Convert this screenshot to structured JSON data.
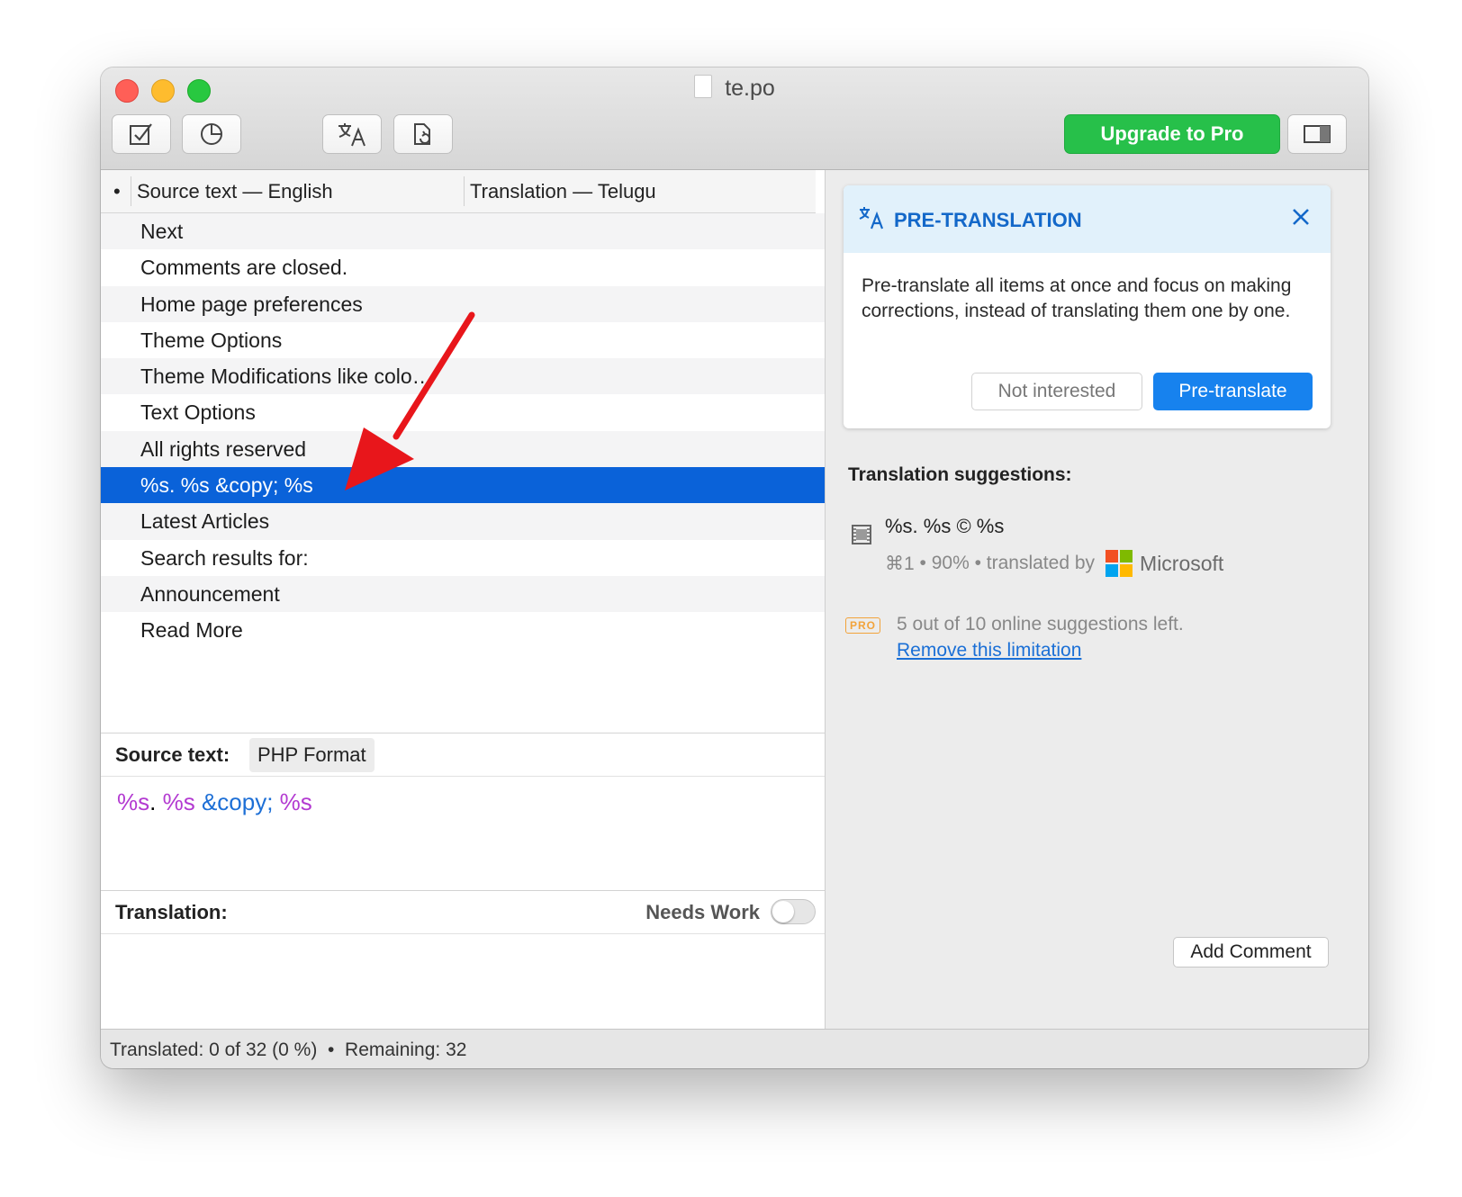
{
  "window": {
    "title": "te.po"
  },
  "toolbar": {
    "buttons": [
      {
        "name": "validate",
        "icon": "checkbox-edit-icon"
      },
      {
        "name": "statistics",
        "icon": "pie-chart-icon"
      },
      {
        "name": "pretranslate",
        "icon": "translate-icon"
      },
      {
        "name": "update",
        "icon": "document-sync-icon"
      },
      {
        "name": "sidebar",
        "icon": "sidebar-toggle-icon"
      }
    ],
    "upgrade_label": "Upgrade to Pro"
  },
  "list": {
    "bullet": "•",
    "col_source": "Source text — English",
    "col_translation": "Translation — Telugu",
    "rows": [
      "Next",
      "Comments are closed.",
      "Home page preferences",
      "Theme Options",
      "Theme Modifications like colo…",
      "Text Options",
      "All rights reserved",
      "%s. %s &copy; %s",
      "Latest Articles",
      "Search results for:",
      "Announcement",
      "Read More"
    ],
    "selected_index": 7
  },
  "source": {
    "label": "Source text:",
    "format_tag": "PHP Format",
    "text_parts": [
      "%s",
      ". ",
      "%s",
      " ",
      "&copy;",
      " ",
      "%s"
    ]
  },
  "translation": {
    "label": "Translation:",
    "needs_work_label": "Needs Work",
    "needs_work_on": false
  },
  "pretranslation": {
    "title": "PRE-TRANSLATION",
    "body": "Pre-translate all items at once and focus on making corrections, instead of translating them one by one.",
    "not_interested_label": "Not interested",
    "pretranslate_label": "Pre-translate"
  },
  "suggestions": {
    "title": "Translation suggestions:",
    "items": [
      {
        "text": "%s. %s © %s",
        "shortcut": "⌘1",
        "match": "90%",
        "translated_by_label": "translated by",
        "provider": "Microsoft"
      }
    ],
    "pro_badge": "PRO",
    "limit_text": "5 out of 10 online suggestions left.",
    "limit_link": "Remove this limitation"
  },
  "add_comment_label": "Add Comment",
  "status": {
    "text": "Translated: 0 of 32 (0 %)  •  Remaining: 32"
  },
  "colors": {
    "selection": "#0a62d9",
    "upgrade": "#27c04a",
    "primary_button": "#1782ee",
    "placeholder": "#b33ad1",
    "entity": "#1d6fd6",
    "annotation_arrow": "#e8161b"
  }
}
